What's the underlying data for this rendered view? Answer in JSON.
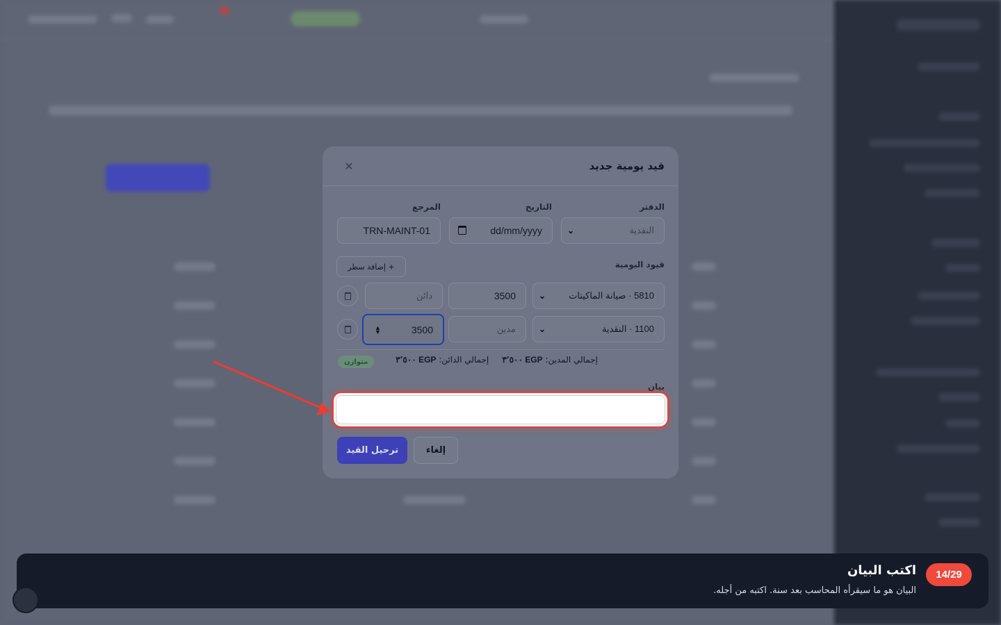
{
  "modal": {
    "title": "قيد يومية جديد",
    "close_icon": "close-icon",
    "fields": {
      "journal_label": "الدفتر",
      "journal_value": "النقدية",
      "date_label": "التاريخ",
      "date_value": "dd/mm/yyyy",
      "reference_label": "المرجع",
      "reference_value": "TRN-MAINT-01"
    },
    "lines_label": "قيود اليومية",
    "add_line_label": "+ إضافة سطر",
    "lines": [
      {
        "account": "5810 · صيانة الماكينات",
        "debit": "3500",
        "credit_placeholder": "دائن"
      },
      {
        "account": "1100 · النقدية",
        "debit_placeholder": "مدين",
        "credit": "3500"
      }
    ],
    "totals": {
      "debit_label": "إجمالي المدين:",
      "debit_value": "EGP ٣٬٥٠٠",
      "credit_label": "إجمالي الدائن:",
      "credit_value": "EGP ٣٬٥٠٠",
      "status": "متوازن"
    },
    "memo_label": "بيان",
    "memo_value": "",
    "post_button": "ترحيل القيد",
    "cancel_button": "إلغاء"
  },
  "tour": {
    "step": "14/29",
    "title": "اكتب البيان",
    "description": "البيان هو ما سيقرأه المحاسب بعد سنة. اكتبه من أجله."
  },
  "colors": {
    "accent": "#3d40b6",
    "highlight": "#ef3b2f",
    "tour_bg": "#161b2a",
    "badge": "#ef4a3c"
  }
}
